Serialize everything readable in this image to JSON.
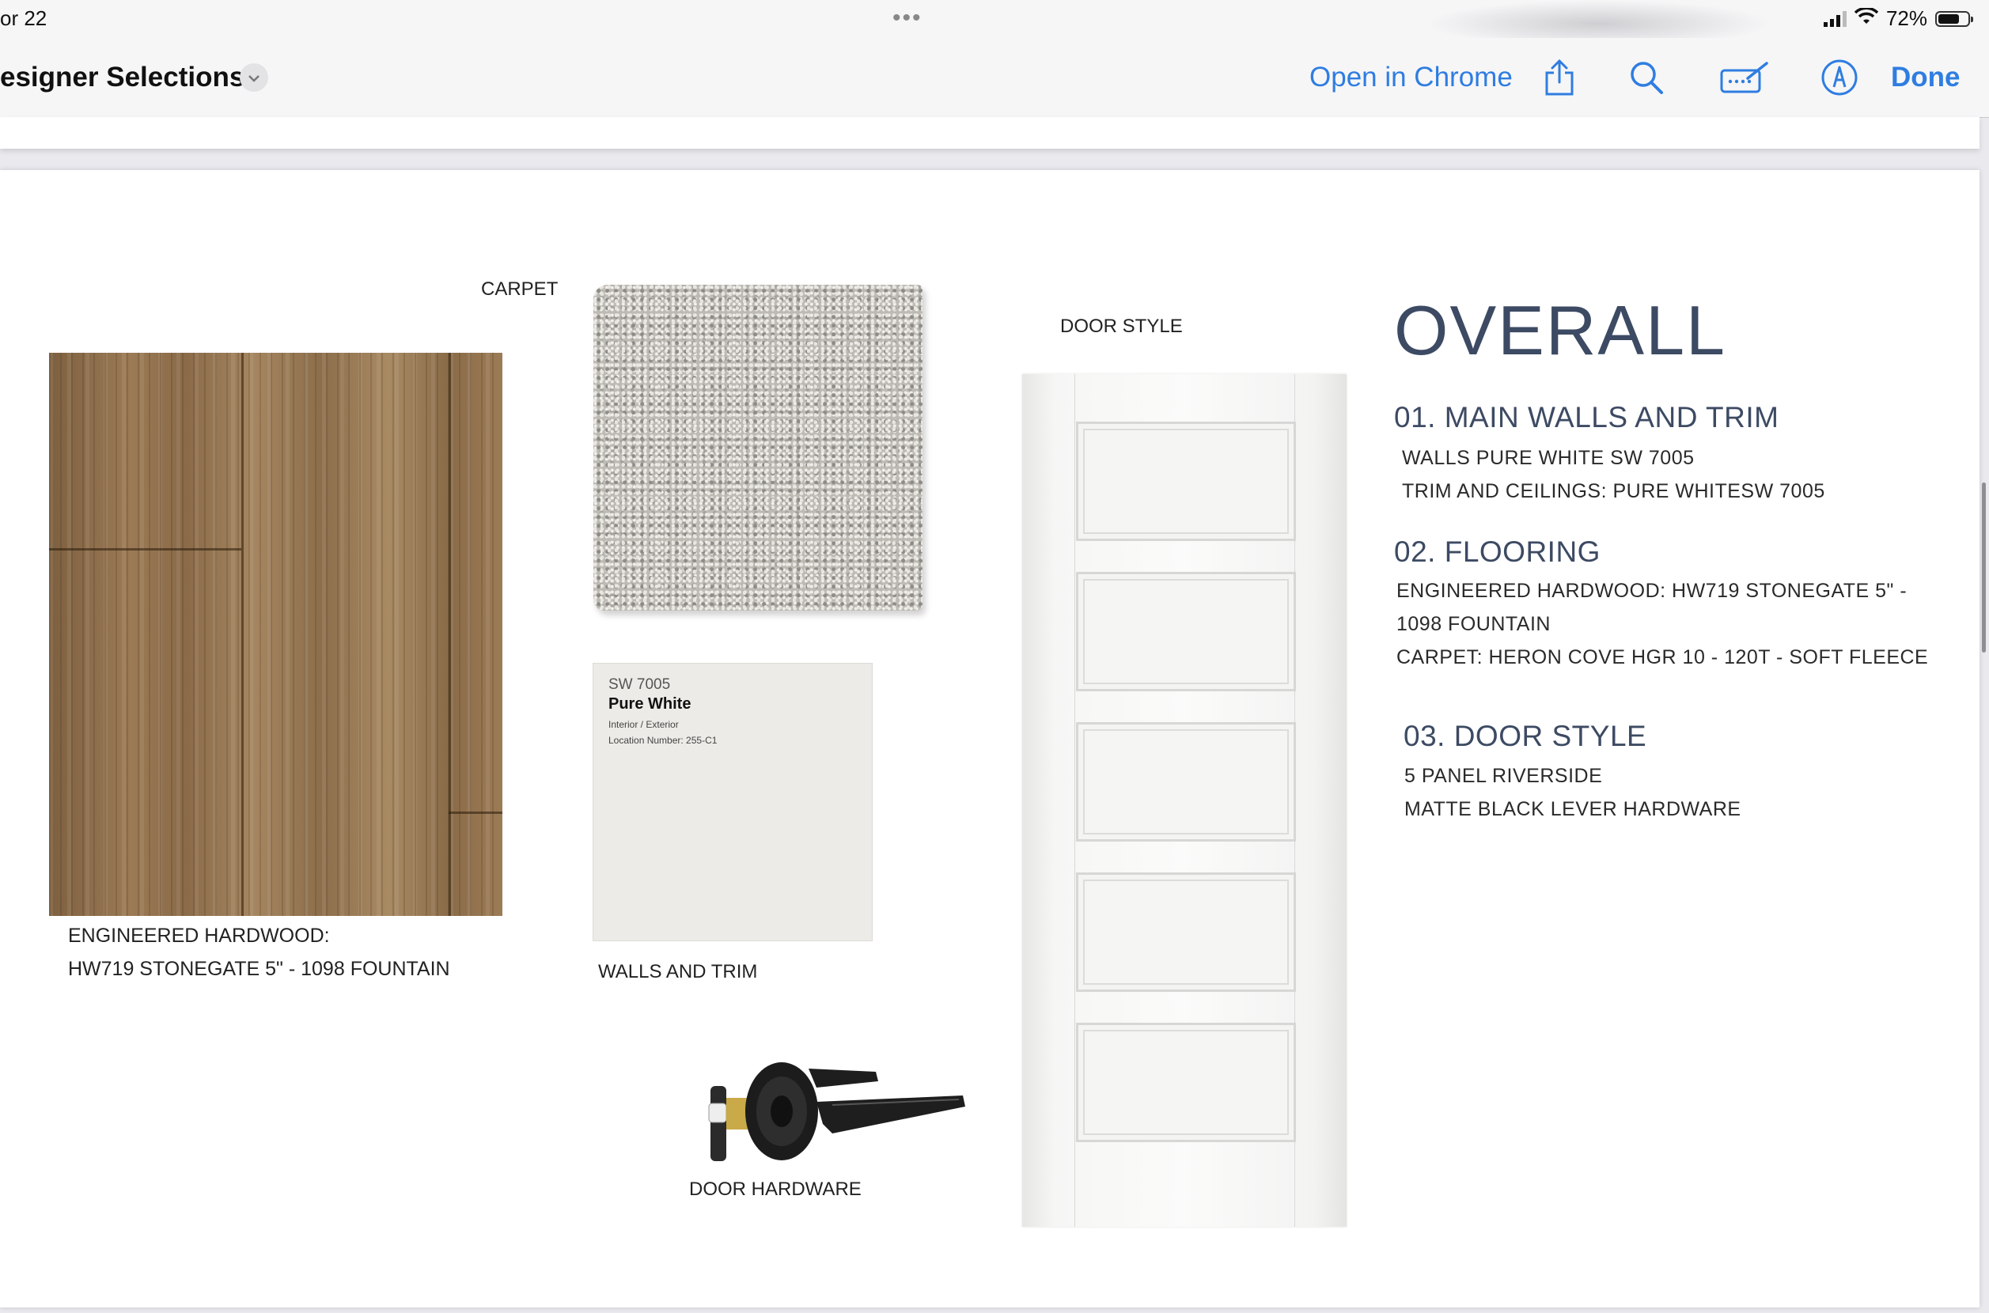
{
  "status_bar": {
    "time": "or 22",
    "battery": "72%",
    "battery_level": 0.72,
    "multitask_dots": "•••"
  },
  "toolbar": {
    "title": "esigner Selections",
    "open_in_chrome": "Open in Chrome",
    "done": "Done",
    "icons": [
      "share-icon",
      "search-icon",
      "markup-keyboard-icon",
      "markup-pen-icon"
    ]
  },
  "board": {
    "hardwood_caption_1": "ENGINEERED HARDWOOD:",
    "hardwood_caption_2": "HW719 STONEGATE 5\" - 1098 FOUNTAIN",
    "carpet_label": "CARPET",
    "chip_number": "SW 7005",
    "chip_name": "Pure White",
    "chip_line1": "Interior / Exterior",
    "chip_line2": "Location Number: 255-C1",
    "walls_label": "WALLS AND TRIM",
    "hardware_label": "DOOR HARDWARE",
    "door_label": "DOOR STYLE"
  },
  "overall": {
    "heading": "OVERALL",
    "sections": [
      {
        "title": "01. MAIN WALLS AND TRIM",
        "lines": [
          "WALLS PURE WHITE SW 7005",
          "TRIM AND CEILINGS: PURE WHITESW 7005"
        ]
      },
      {
        "title": "02. FLOORING",
        "lines": [
          "ENGINEERED HARDWOOD: HW719 STONEGATE 5\" -",
          "1098 FOUNTAIN",
          "CARPET: HERON COVE HGR 10 - 120T - SOFT FLEECE"
        ]
      },
      {
        "title": "03. DOOR STYLE",
        "lines": [
          "5 PANEL RIVERSIDE",
          "MATTE BLACK LEVER HARDWARE"
        ]
      }
    ]
  },
  "colors": {
    "accent_blue": "#2f7de1",
    "heading_navy": "#3d4a63"
  }
}
